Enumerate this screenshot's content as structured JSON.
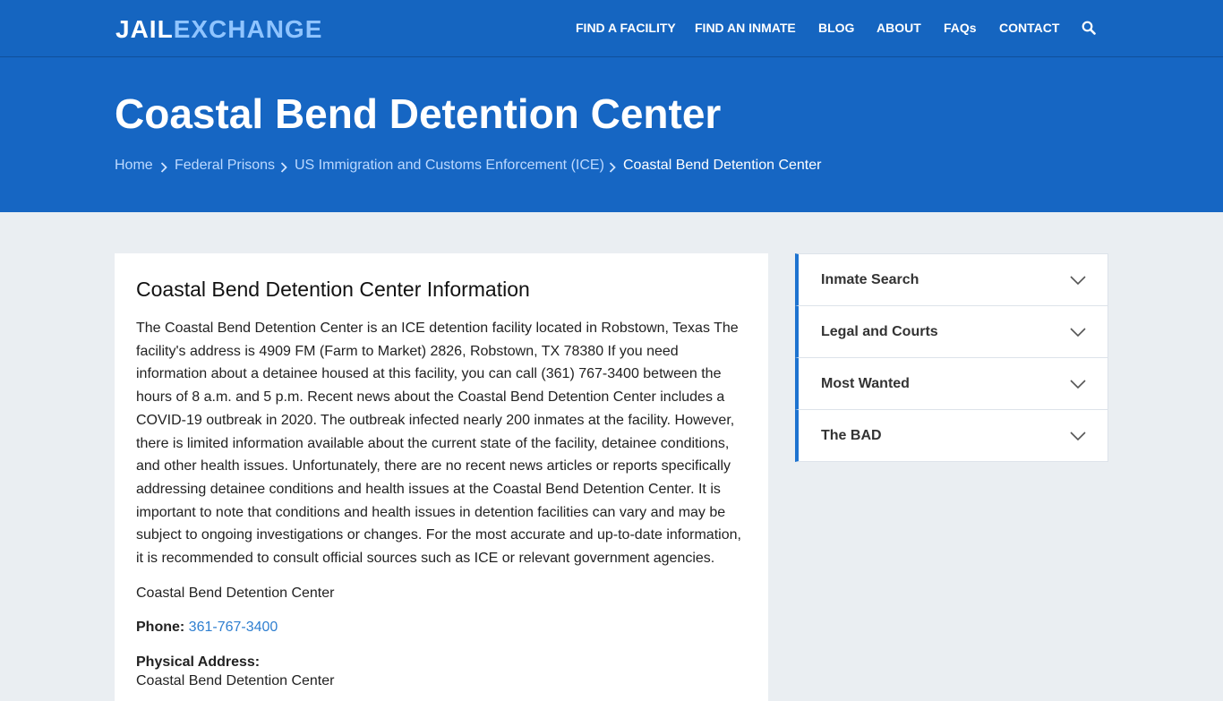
{
  "header": {
    "logo_part1": "JAIL",
    "logo_part2": "EXCHANGE",
    "nav": [
      {
        "label": "FIND A FACILITY"
      },
      {
        "label": "FIND AN INMATE"
      },
      {
        "label": "BLOG"
      },
      {
        "label": "ABOUT"
      },
      {
        "label": "FAQs"
      },
      {
        "label": "CONTACT"
      }
    ],
    "search_icon": "search-icon"
  },
  "hero": {
    "title": "Coastal Bend Detention Center",
    "breadcrumb": [
      {
        "label": "Home"
      },
      {
        "label": "Federal Prisons"
      },
      {
        "label": "US Immigration and Customs Enforcement (ICE)"
      },
      {
        "label": "Coastal Bend Detention Center"
      }
    ]
  },
  "main": {
    "heading": "Coastal Bend Detention Center Information",
    "description": "The Coastal Bend Detention Center is an ICE detention facility located in Robstown, Texas The facility's address is 4909 FM (Farm to Market) 2826, Robstown, TX 78380 If you need information about a detainee housed at this facility, you can call (361) 767-3400 between the hours of 8 a.m. and 5 p.m. Recent news about the Coastal Bend Detention Center includes a COVID-19 outbreak in 2020. The outbreak infected nearly 200 inmates at the facility. However, there is limited information available about the current state of the facility, detainee conditions, and other health issues. Unfortunately, there are no recent news articles or reports specifically addressing detainee conditions and health issues at the Coastal Bend Detention Center. It is important to note that conditions and health issues in detention facilities can vary and may be subject to ongoing investigations or changes. For the most accurate and up-to-date information, it is recommended to consult official sources such as ICE or relevant government agencies.",
    "facility_name": "Coastal Bend Detention Center",
    "phone_label": "Phone:",
    "phone_value": "361-767-3400",
    "address_label": "Physical Address:",
    "address_line1": "Coastal Bend Detention Center"
  },
  "sidebar": {
    "items": [
      {
        "label": "Inmate Search"
      },
      {
        "label": "Legal and Courts"
      },
      {
        "label": "Most Wanted"
      },
      {
        "label": "The BAD"
      }
    ]
  },
  "colors": {
    "header_bg": "#1565c0",
    "hero_bg": "#1666c3",
    "accent": "#1e73d0",
    "link": "#2f7fd0",
    "page_bg": "#eaeef2"
  }
}
